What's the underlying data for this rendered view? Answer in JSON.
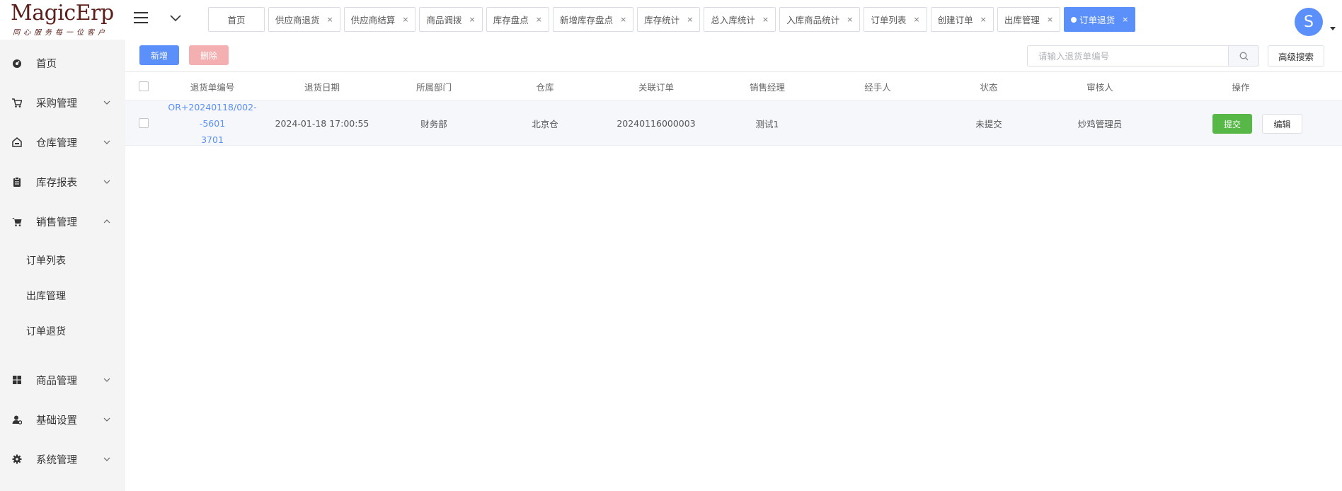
{
  "logo": {
    "title": "MagicErp",
    "slogan": "同心服务每一位客户"
  },
  "tabs": [
    {
      "label": "首页",
      "closable": false,
      "active": false
    },
    {
      "label": "供应商退货",
      "closable": true,
      "active": false
    },
    {
      "label": "供应商结算",
      "closable": true,
      "active": false
    },
    {
      "label": "商品调拨",
      "closable": true,
      "active": false
    },
    {
      "label": "库存盘点",
      "closable": true,
      "active": false
    },
    {
      "label": "新增库存盘点",
      "closable": true,
      "active": false
    },
    {
      "label": "库存统计",
      "closable": true,
      "active": false
    },
    {
      "label": "总入库统计",
      "closable": true,
      "active": false
    },
    {
      "label": "入库商品统计",
      "closable": true,
      "active": false
    },
    {
      "label": "订单列表",
      "closable": true,
      "active": false
    },
    {
      "label": "创建订单",
      "closable": true,
      "active": false
    },
    {
      "label": "出库管理",
      "closable": true,
      "active": false
    },
    {
      "label": "订单退货",
      "closable": true,
      "active": true
    }
  ],
  "tab_close_glyph": "×",
  "user": {
    "avatar_letter": "S"
  },
  "sidebar": {
    "items": [
      {
        "label": "首页",
        "icon": "dashboard-icon",
        "expandable": false
      },
      {
        "label": "采购管理",
        "icon": "cart-icon",
        "expandable": true,
        "expanded": false
      },
      {
        "label": "仓库管理",
        "icon": "warehouse-icon",
        "expandable": true,
        "expanded": false
      },
      {
        "label": "库存报表",
        "icon": "clipboard-icon",
        "expandable": true,
        "expanded": false
      },
      {
        "label": "销售管理",
        "icon": "shopping-cart-icon",
        "expandable": true,
        "expanded": true
      },
      {
        "label": "商品管理",
        "icon": "grid-icon",
        "expandable": true,
        "expanded": false
      },
      {
        "label": "基础设置",
        "icon": "user-settings-icon",
        "expandable": true,
        "expanded": false
      },
      {
        "label": "系统管理",
        "icon": "gear-icon",
        "expandable": true,
        "expanded": false
      }
    ],
    "sales_sub": [
      "订单列表",
      "出库管理",
      "订单退货"
    ]
  },
  "toolbar": {
    "add_label": "新增",
    "delete_label": "删除",
    "search_placeholder": "请输入退货单编号",
    "advanced_search_label": "高级搜索"
  },
  "table": {
    "columns": [
      "退货单编号",
      "退货日期",
      "所属部门",
      "仓库",
      "关联订单",
      "销售经理",
      "经手人",
      "状态",
      "审核人",
      "操作"
    ],
    "rows": [
      {
        "id_line1": "OR+20240118/002--5601",
        "id_line2": "3701",
        "date": "2024-01-18 17:00:55",
        "department": "财务部",
        "warehouse": "北京仓",
        "order": "20240116000003",
        "manager": "测试1",
        "handler": "",
        "status": "未提交",
        "reviewer": "炒鸡管理员",
        "submit_label": "提交",
        "edit_label": "编辑"
      }
    ]
  },
  "colors": {
    "primary": "#5b8ff9",
    "success": "#57b847",
    "danger_disabled": "#f4b0b0",
    "sidebar_bg": "#f4f4f5",
    "logo": "#5a1f1a"
  }
}
